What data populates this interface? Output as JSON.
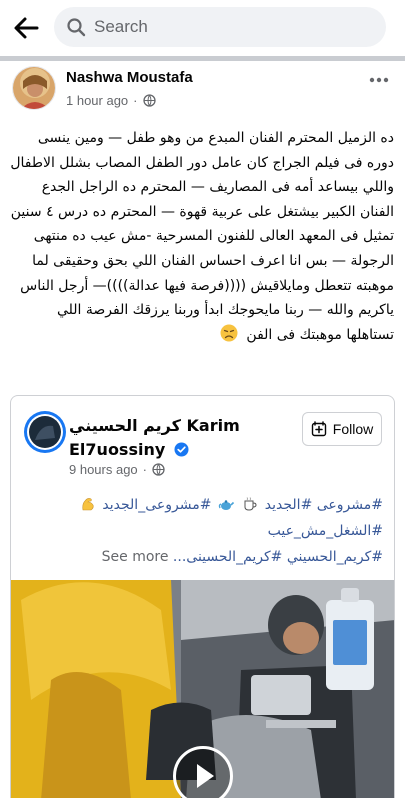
{
  "topbar": {
    "back_icon": "arrow-left-icon",
    "search_icon": "search-icon",
    "search_placeholder": "Search"
  },
  "post": {
    "author": "Nashwa Moustafa",
    "time": "1 hour ago",
    "separator": "·",
    "privacy_icon": "globe-icon",
    "text": "ده الزميل المحترم الفنان المبدع من وهو طفل — ومين ينسى دوره فى فيلم الجراج كان عامل دور الطفل المصاب بشلل الاطفال واللي بيساعد أمه فى المصاريف — المحترم ده الراجل الجدع الفنان الكبير بيشتغل على عربية قهوة — المحترم ده درس ٤ سنين تمثيل فى المعهد العالى للفنون المسرحية -مش عيب ده منتهى الرجولة — بس انا اعرف احساس الفنان اللي بحق وحقيقى لما موهبته تتعطل ومايلاقيش ((((فرصة فيها عدالة))))— أرجل الناس ياكريم والله — ربنا مايحوجك ابدأ وربنا يرزقك الفرصة اللي تستاهلها موهبتك فى الفن",
    "emoji": "sad-face-icon"
  },
  "shared": {
    "name": "كريم الحسيني Karim El7uossiny",
    "verified_icon": "verified-badge-icon",
    "time": "9 hours ago",
    "separator": "·",
    "follow_label": "Follow",
    "hashtags": {
      "line1_a": "#مشروعى",
      "line1_b": "#الجديد",
      "line1_c": "#مشروعى_الجديد",
      "line2": "#الشغل_مش_عيب",
      "line3_a": "#كريم_الحسيني",
      "line3_b": "#كريم_الحسينى..."
    },
    "see_more": "See more",
    "emojis": [
      "coffee-cup-icon",
      "teapot-icon",
      "flexed-biceps-icon"
    ]
  },
  "video": {
    "play_icon": "play-icon"
  },
  "colors": {
    "link": "#385898",
    "muted": "#65676b",
    "verified": "#1877f2",
    "search_bg": "#f0f2f5"
  }
}
